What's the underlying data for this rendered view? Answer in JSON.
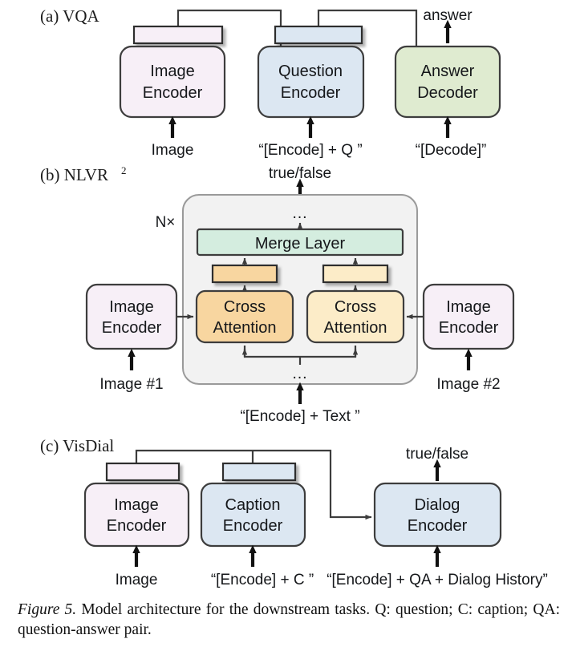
{
  "figure": {
    "caption_label": "Figure 5.",
    "caption_text": " Model architecture for the downstream tasks.  Q: question; C: caption; QA: question-answer pair."
  },
  "colors": {
    "image_encoder_fill": "#f7eff7",
    "text_encoder_fill": "#dce7f2",
    "answer_decoder_fill": "#dfebd0",
    "merge_layer_fill": "#d4eddf",
    "cross_attention_left_fill": "#f8d6a0",
    "cross_attention_right_fill": "#fcecc8",
    "group_fill": "#f2f2f2",
    "stroke": "#3d3d3d",
    "text": "#15171a"
  },
  "panels": [
    {
      "id": "vqa",
      "label": "(a) VQA",
      "label_sup": "",
      "boxes": [
        {
          "name": "image-encoder",
          "line1": "Image",
          "line2": "Encoder",
          "fill_key": "image_encoder_fill"
        },
        {
          "name": "question-encoder",
          "line1": "Question",
          "line2": "Encoder",
          "fill_key": "text_encoder_fill"
        },
        {
          "name": "answer-decoder",
          "line1": "Answer",
          "line2": "Decoder",
          "fill_key": "answer_decoder_fill"
        }
      ],
      "inputs": [
        {
          "name": "image-input",
          "text": "Image"
        },
        {
          "name": "question-input",
          "text": "“[Encode] + Q ”"
        },
        {
          "name": "decode-input",
          "text": "“[Decode]”"
        }
      ],
      "outputs": [
        {
          "name": "answer-output",
          "text": "answer"
        }
      ]
    },
    {
      "id": "nlvr2",
      "label": "(b) NLVR",
      "label_sup": "2",
      "repeat_label": "N×",
      "output": "true/false",
      "dots_top": "…",
      "dots_bottom": "…",
      "boxes": [
        {
          "name": "image-encoder-left",
          "line1": "Image",
          "line2": "Encoder",
          "fill_key": "image_encoder_fill"
        },
        {
          "name": "cross-attention-left",
          "line1": "Cross",
          "line2": "Attention",
          "fill_key": "cross_attention_left_fill"
        },
        {
          "name": "cross-attention-right",
          "line1": "Cross",
          "line2": "Attention",
          "fill_key": "cross_attention_right_fill"
        },
        {
          "name": "image-encoder-right",
          "line1": "Image",
          "line2": "Encoder",
          "fill_key": "image_encoder_fill"
        },
        {
          "name": "merge-layer",
          "line1": "Merge Layer",
          "line2": "",
          "fill_key": "merge_layer_fill"
        }
      ],
      "inputs": [
        {
          "name": "image1-input",
          "text": "Image #1"
        },
        {
          "name": "text-input",
          "text": "“[Encode] + Text ”"
        },
        {
          "name": "image2-input",
          "text": "Image #2"
        }
      ]
    },
    {
      "id": "visdial",
      "label": "(c) VisDial",
      "label_sup": "",
      "output": "true/false",
      "boxes": [
        {
          "name": "image-encoder",
          "line1": "Image",
          "line2": "Encoder",
          "fill_key": "image_encoder_fill"
        },
        {
          "name": "caption-encoder",
          "line1": "Caption",
          "line2": "Encoder",
          "fill_key": "text_encoder_fill"
        },
        {
          "name": "dialog-encoder",
          "line1": "Dialog",
          "line2": "Encoder",
          "fill_key": "text_encoder_fill"
        }
      ],
      "inputs": [
        {
          "name": "image-input",
          "text": "Image"
        },
        {
          "name": "caption-input",
          "text": "“[Encode] + C ”"
        },
        {
          "name": "dialog-input",
          "text": "“[Encode] + QA + Dialog History”"
        }
      ]
    }
  ]
}
